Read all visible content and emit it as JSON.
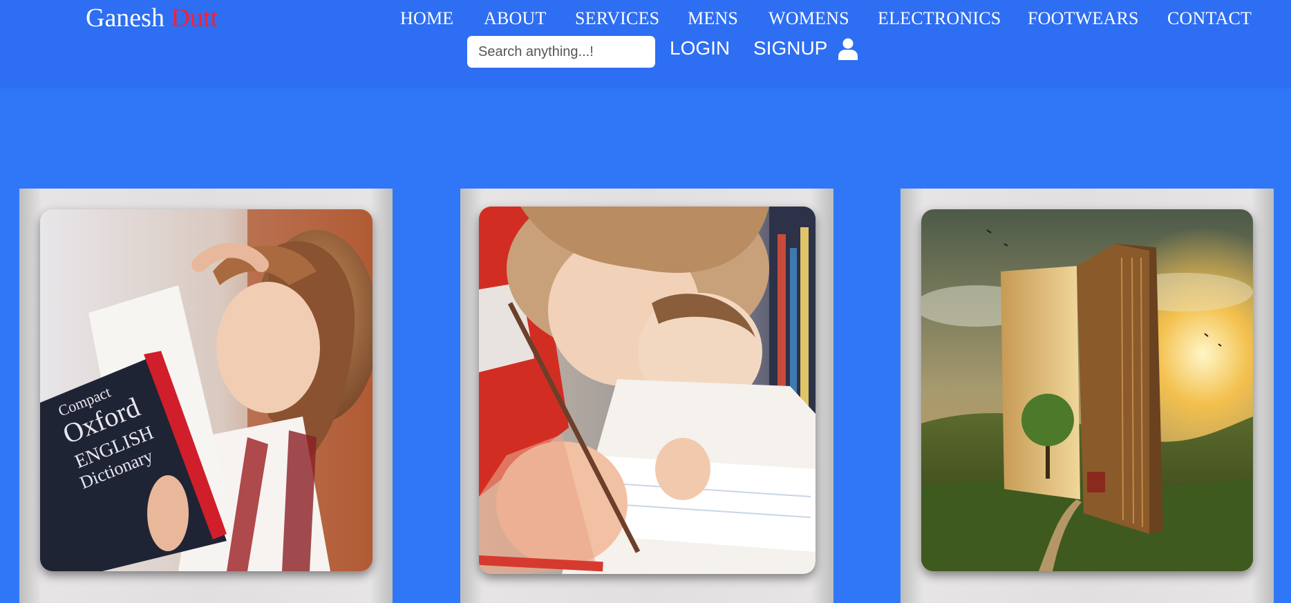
{
  "brand": {
    "first": "Ganesh",
    "last": "Dutt"
  },
  "nav": {
    "items": [
      "HOME",
      "ABOUT",
      "SERVICES",
      "MENS",
      "WOMENS",
      "ELECTRONICS",
      "FOOTWEARS",
      "CONTACT"
    ]
  },
  "search": {
    "placeholder": "Search anything...!"
  },
  "auth": {
    "login": "LOGIN",
    "signup": "SIGNUP",
    "icon": "user-icon"
  },
  "cards": [
    {
      "image": "girl-reading-dictionary-photo",
      "book_text": [
        "Compact",
        "Oxford",
        "ENGLISH",
        "Dictionary"
      ]
    },
    {
      "image": "children-writing-photo"
    },
    {
      "image": "giant-book-landscape-photo"
    }
  ],
  "colors": {
    "background": "#3077f7",
    "header": "#2e6ef2",
    "brand_accent": "#ff1e2e",
    "card": "#e1dfdf"
  }
}
